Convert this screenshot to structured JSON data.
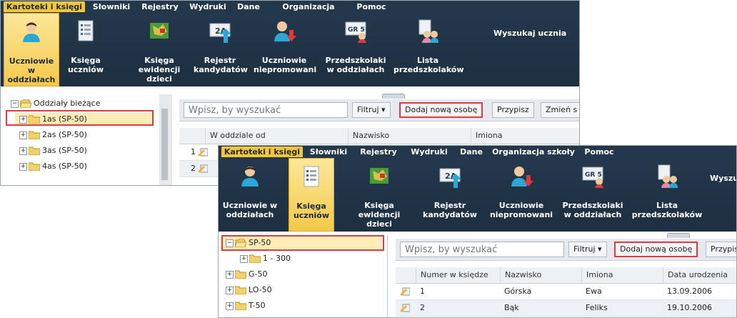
{
  "menu": {
    "items": [
      "Kartoteki i księgi",
      "Słowniki",
      "Rejestry",
      "Wydruki",
      "Dane",
      "Organizacja szkoły",
      "Pomoc"
    ],
    "active_index": 0
  },
  "ribbon": {
    "buttons": [
      {
        "label": "Uczniowie w\noddziałach",
        "icon": "student-icon"
      },
      {
        "label": "Księga\nuczniów",
        "icon": "book-list-icon"
      },
      {
        "label": "Księga\newidencji dzieci",
        "icon": "map-book-icon"
      },
      {
        "label": "Rejestr\nkandydatów",
        "icon": "register-2a-icon"
      },
      {
        "label": "Uczniowie\nniepromowani",
        "icon": "student-down-icon"
      },
      {
        "label": "Przedszkolaki\nw oddziałach",
        "icon": "grade-5-icon"
      },
      {
        "label": "Lista\nprzedszkolaków",
        "icon": "children-list-icon"
      }
    ],
    "search_label_full": "Wyszukaj ucznia",
    "search_label_partial": "Wyszu"
  },
  "window1": {
    "active_ribbon_index": 0,
    "tree": [
      {
        "label": "Oddziały bieżące",
        "level": 0,
        "open": true
      },
      {
        "label": "1as (SP-50)",
        "level": 1,
        "selected": true
      },
      {
        "label": "2as (SP-50)",
        "level": 1
      },
      {
        "label": "3as (SP-50)",
        "level": 1
      },
      {
        "label": "4as (SP-50)",
        "level": 1
      }
    ],
    "search_placeholder": "Wpisz, by wyszukać",
    "buttons": {
      "filter": "Filtruj",
      "add": "Dodaj nową osobę",
      "assign": "Przypisz",
      "change": "Zmień s"
    },
    "columns": [
      "W oddziale od",
      "Nazwisko",
      "Imiona"
    ],
    "row_numbers": [
      "1",
      "2"
    ]
  },
  "window2": {
    "active_ribbon_index": 1,
    "tree": [
      {
        "label": "SP-50",
        "level": 0,
        "open": true,
        "selected": true
      },
      {
        "label": "1 - 300",
        "level": 1
      },
      {
        "label": "G-50",
        "level": 0
      },
      {
        "label": "LO-50",
        "level": 0
      },
      {
        "label": "T-50",
        "level": 0
      }
    ],
    "search_placeholder": "Wpisz, by wyszukać",
    "buttons": {
      "filter": "Filtruj",
      "add": "Dodaj nową osobę",
      "assign": "Przypis"
    },
    "columns": [
      "Numer w księdze",
      "Nazwisko",
      "Imiona",
      "Data urodzenia"
    ],
    "rows": [
      {
        "num": "1",
        "nazwisko": "Górska",
        "imiona": "Ewa",
        "data": "13.09.2006"
      },
      {
        "num": "2",
        "nazwisko": "Bąk",
        "imiona": "Feliks",
        "data": "19.10.2006"
      }
    ]
  },
  "colors": {
    "menubar": "#24384c",
    "active": "#f5c63a",
    "highlight": "#e0393e",
    "selection": "#fcedb7"
  }
}
